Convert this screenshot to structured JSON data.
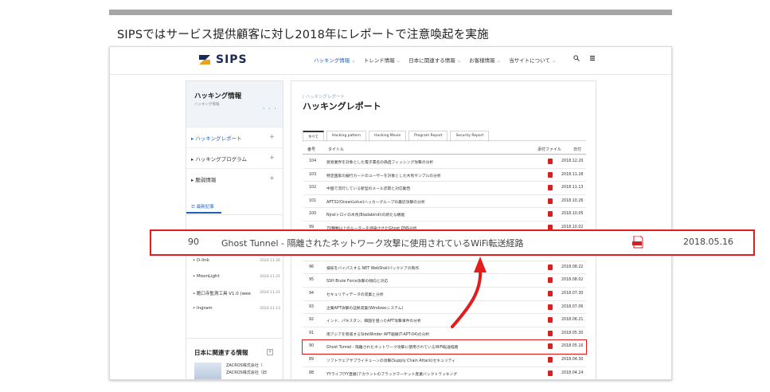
{
  "headline": "SIPSではサービス提供顧客に対し2018年にレポートで注意喚起を実施",
  "site": {
    "logo": "SIPS",
    "nav": [
      {
        "label": "ハッキング情報",
        "active": true
      },
      {
        "label": "トレンド情報",
        "active": false
      },
      {
        "label": "日本に関連する情報",
        "active": false
      },
      {
        "label": "お客様情報",
        "active": false
      },
      {
        "label": "当サイトについて",
        "active": false
      }
    ],
    "search_icon": "search-icon",
    "menu_icon": "menu-icon"
  },
  "sidebar": {
    "title": "ハッキング情報",
    "subtitle": "ハッキング情報",
    "items": [
      {
        "label": "ハッキングレポート",
        "active": true
      },
      {
        "label": "ハッキングプログラム",
        "active": false
      },
      {
        "label": "脆弱情報",
        "active": false
      }
    ],
    "recent_tab": "最新記事",
    "recent": [
      {
        "label": "D-link",
        "date": "2024.11.26"
      },
      {
        "label": "MoonLight",
        "date": "2024.11.21"
      },
      {
        "label": "脆口寺監測工具 V1.0 (wee",
        "date": "2024.11.21"
      },
      {
        "label": "Ingram",
        "date": "2024.11.13"
      }
    ],
    "related_title": "日本に関連する情報",
    "related_text": [
      "ZACROS株式会社（",
      "ZACROS株式会社（旧"
    ]
  },
  "main": {
    "breadcrumb": "ハッキングレポート",
    "title": "ハッキングレポート",
    "tabs": [
      "すべて",
      "Hacking pattern",
      "Hacking Movie",
      "Program Report",
      "Security Report"
    ],
    "columns": {
      "no": "番号",
      "title": "タイトル",
      "file": "添付ファイル",
      "date": "日付"
    },
    "rows": [
      {
        "no": "104",
        "title": "貿易業界を対象とした電子署名の偽造フィッシング攻撃の分析",
        "date": "2018.12.20"
      },
      {
        "no": "103",
        "title": "特定国家の銀行カードのユーザーを対象とした木馬サンプルの分析",
        "date": "2018.11.28"
      },
      {
        "no": "102",
        "title": "中国で流行している新型のメール詐欺と対応動告",
        "date": "2018.11.13"
      },
      {
        "no": "101",
        "title": "APT32(OceanLotus)ハッカーグループの最近攻撃の分析",
        "date": "2018.10.26"
      },
      {
        "no": "100",
        "title": "Njratトロイの木馬(Bladabindi)の新たな機能",
        "date": "2018.10.05"
      },
      {
        "no": "99",
        "title": "70種類以上のルーターを感染させたGhost DNS分析",
        "date": "2018.10.02"
      },
      {
        "no": "",
        "title": "",
        "date": ""
      },
      {
        "no": "",
        "title": "",
        "date": ""
      },
      {
        "no": "96",
        "title": "検知をバイパスする.NET WebShellバックドアの製作",
        "date": "2018.08.22"
      },
      {
        "no": "95",
        "title": "SSH Brute Force攻撃の傾向と対応",
        "date": "2018.08.02"
      },
      {
        "no": "94",
        "title": "セキュリティデータの収集と分析",
        "date": "2018.07.30"
      },
      {
        "no": "93",
        "title": "企業APT攻撃の証拠収集(Windowsシステム)",
        "date": "2018.07.06"
      },
      {
        "no": "92",
        "title": "インド、パキスタン、韓国を狙ったAPT攻撃事件の分析",
        "date": "2018.06.21"
      },
      {
        "no": "91",
        "title": "南アジアを脅威するSideWinder APT組織(T-APT-04)の分析",
        "date": "2018.05.30"
      },
      {
        "no": "90",
        "title": "Ghost Tunnel - 隔離されたネットワーク攻撃に使用されているWiFi転送経路",
        "date": "2018.05.16",
        "highlight": true
      },
      {
        "no": "89",
        "title": "ソフトウェアサプライチェーンの攻撃(Supply Chain Attack)セキュリティ",
        "date": "2018.04.30"
      },
      {
        "no": "88",
        "title": "YYライブ(YY直播)アカウントのブラックマーケット産業バックトラッキング",
        "date": "2018.04.24"
      },
      {
        "no": "87",
        "title": "Office脆弱性とAutoITスクリプトを利用した攻撃のサンプル分析",
        "date": "2018.04.13"
      }
    ]
  },
  "banner": {
    "no": "90",
    "title": "Ghost Tunnel - 隔離されたネットワーク攻撃に使用されているWiFi転送経路",
    "date": "2018.05.16"
  },
  "colors": {
    "accent": "#1e62b8",
    "highlight": "#e31c1c",
    "pdf": "#d92020"
  }
}
